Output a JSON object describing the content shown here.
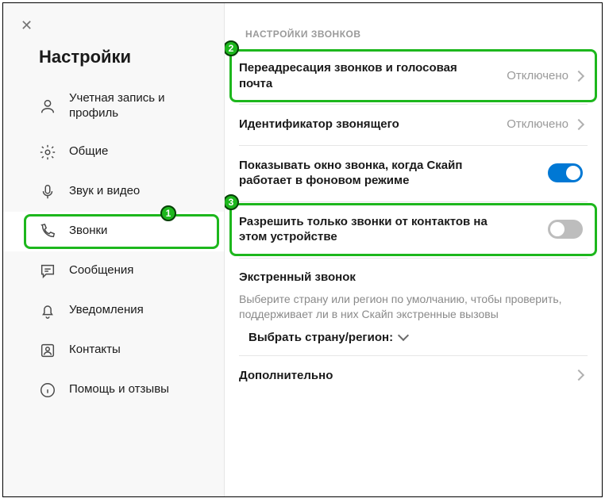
{
  "sidebar": {
    "title": "Настройки",
    "items": [
      {
        "label": "Учетная запись и профиль"
      },
      {
        "label": "Общие"
      },
      {
        "label": "Звук и видео"
      },
      {
        "label": "Звонки"
      },
      {
        "label": "Сообщения"
      },
      {
        "label": "Уведомления"
      },
      {
        "label": "Контакты"
      },
      {
        "label": "Помощь и отзывы"
      }
    ]
  },
  "content": {
    "section_title": "НАСТРОЙКИ ЗВОНКОВ",
    "forwarding": {
      "label": "Переадресация звонков и голосовая почта",
      "status": "Отключено"
    },
    "caller_id": {
      "label": "Идентификатор звонящего",
      "status": "Отключено"
    },
    "incoming_window": {
      "label": "Показывать окно звонка, когда Скайп работает в фоновом режиме",
      "enabled": true
    },
    "only_contacts": {
      "label": "Разрешить только звонки от контактов на этом устройстве",
      "enabled": false
    },
    "emergency": {
      "title": "Экстренный звонок",
      "desc": "Выберите страну или регион по умолчанию, чтобы проверить, поддерживает ли в них Скайп экстренные вызовы",
      "picker": "Выбрать страну/регион:"
    },
    "more": {
      "label": "Дополнительно"
    }
  },
  "annotations": {
    "b1": "1",
    "b2": "2",
    "b3": "3"
  }
}
